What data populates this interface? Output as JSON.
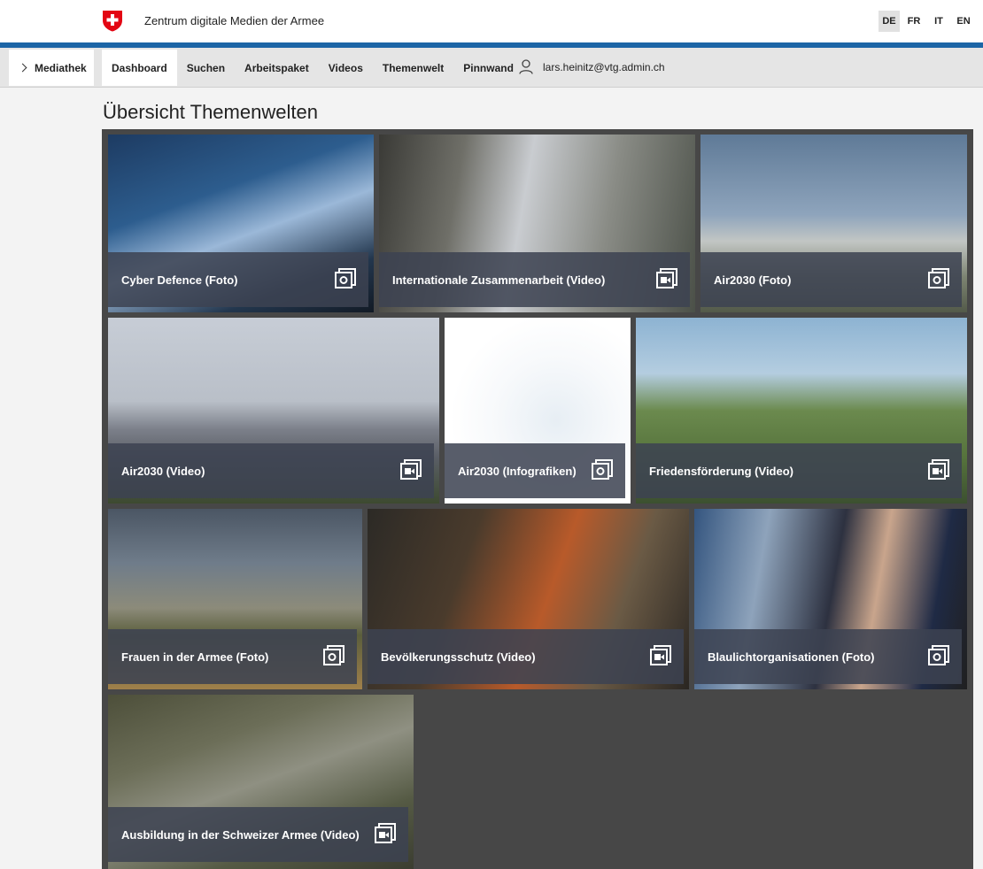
{
  "header": {
    "site_title": "Zentrum digitale Medien der Armee",
    "languages": [
      {
        "code": "DE",
        "active": true
      },
      {
        "code": "FR",
        "active": false
      },
      {
        "code": "IT",
        "active": false
      },
      {
        "code": "EN",
        "active": false
      }
    ]
  },
  "colors": {
    "accent": "#1c65a6",
    "swiss_red": "#e30613",
    "caption_bg": "#3c4252"
  },
  "nav": {
    "mediathek": "Mediathek",
    "items": [
      "Dashboard",
      "Suchen",
      "Arbeitspaket",
      "Videos",
      "Themenwelt",
      "Pinnwand"
    ],
    "active": "Dashboard",
    "user": "lars.heinitz@vtg.admin.ch"
  },
  "main": {
    "title": "Übersicht Themenwelten",
    "tiles": [
      {
        "label": "Cyber Defence (Foto)",
        "media": "photo-icon"
      },
      {
        "label": "Internationale Zusammenarbeit (Video)",
        "media": "video-icon"
      },
      {
        "label": "Air2030 (Foto)",
        "media": "photo-icon"
      },
      {
        "label": "Air2030 (Video)",
        "media": "video-icon"
      },
      {
        "label": "Air2030 (Infografiken)",
        "media": "photo-icon"
      },
      {
        "label": "Friedensförderung (Video)",
        "media": "video-icon"
      },
      {
        "label": "Frauen in der Armee (Foto)",
        "media": "photo-icon"
      },
      {
        "label": "Bevölkerungsschutz (Video)",
        "media": "video-icon"
      },
      {
        "label": "Blaulichtorganisationen (Foto)",
        "media": "photo-icon"
      },
      {
        "label": "Ausbildung in der Schweizer Armee (Video)",
        "media": "video-icon"
      }
    ]
  }
}
